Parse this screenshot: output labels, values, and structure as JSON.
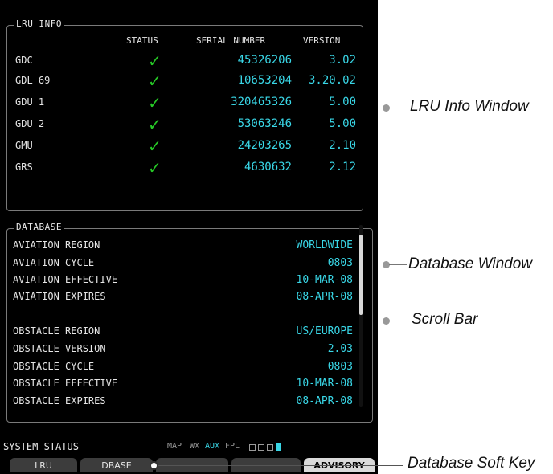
{
  "lru": {
    "title": "LRU INFO",
    "headers": {
      "status": "STATUS",
      "serial": "SERIAL NUMBER",
      "version": "VERSION"
    },
    "rows": [
      {
        "name": "GDC",
        "status": "✓",
        "serial": "45326206",
        "version": "3.02"
      },
      {
        "name": "GDL 69",
        "status": "✓",
        "serial": "10653204",
        "version": "3.20.02"
      },
      {
        "name": "GDU 1",
        "status": "✓",
        "serial": "320465326",
        "version": "5.00"
      },
      {
        "name": "GDU 2",
        "status": "✓",
        "serial": "53063246",
        "version": "5.00"
      },
      {
        "name": "GMU",
        "status": "✓",
        "serial": "24203265",
        "version": "2.10"
      },
      {
        "name": "GRS",
        "status": "✓",
        "serial": "4630632",
        "version": "2.12"
      }
    ]
  },
  "database": {
    "title": "DATABASE",
    "rows": [
      {
        "label": "AVIATION REGION",
        "value": "WORLDWIDE"
      },
      {
        "label": "AVIATION CYCLE",
        "value": "0803"
      },
      {
        "label": "AVIATION EFFECTIVE",
        "value": "10-MAR-08"
      },
      {
        "label": "AVIATION EXPIRES",
        "value": "08-APR-08"
      },
      {
        "label": "OBSTACLE REGION",
        "value": "US/EUROPE"
      },
      {
        "label": "OBSTACLE VERSION",
        "value": "2.03"
      },
      {
        "label": "OBSTACLE CYCLE",
        "value": "0803"
      },
      {
        "label": "OBSTACLE EFFECTIVE",
        "value": "10-MAR-08"
      },
      {
        "label": "OBSTACLE EXPIRES",
        "value": "08-APR-08"
      }
    ]
  },
  "status_bar": {
    "title": "SYSTEM STATUS",
    "pages": [
      "MAP",
      "WX",
      "AUX",
      "FPL"
    ],
    "active_page": "AUX"
  },
  "softkeys": [
    "LRU",
    "DBASE",
    "",
    "",
    "ADVISORY"
  ],
  "callouts": {
    "lru_window": "LRU Info Window",
    "database_window": "Database Window",
    "scroll_bar": "Scroll Bar",
    "database_softkey": "Database Soft Key"
  },
  "colors": {
    "check": "#26c826",
    "value": "#39d6e6",
    "bezel": "#000000"
  }
}
